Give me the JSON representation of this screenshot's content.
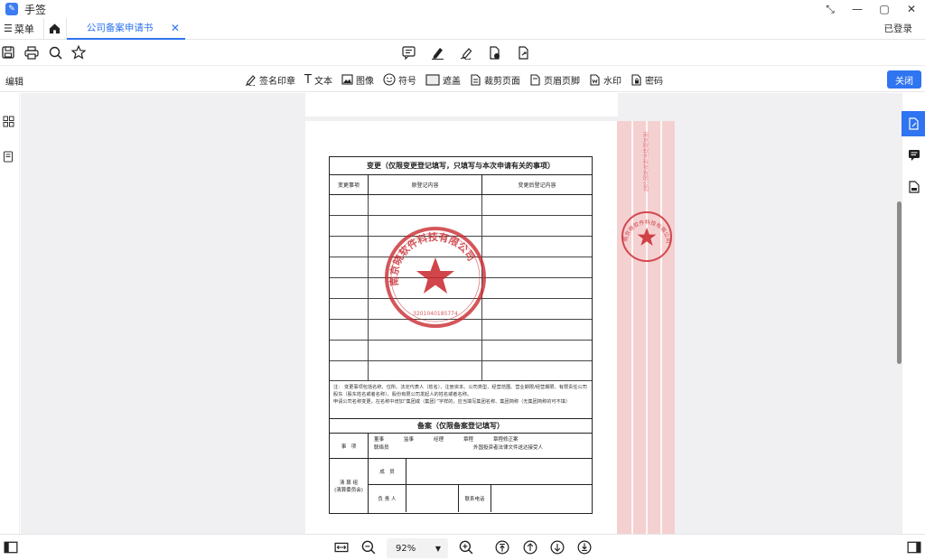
{
  "app": {
    "title": "手签",
    "icon": "app-logo-icon"
  },
  "window_controls": [
    "minimize-icon",
    "maximize-icon",
    "close-icon"
  ],
  "tabs": {
    "menu_label": "菜单",
    "active_tab": "公司备案申请书",
    "login": "已登录"
  },
  "toolbar_top": {
    "left_icons": [
      "save-icon",
      "print-icon",
      "search-icon",
      "star-icon"
    ],
    "center_icons": [
      "comment-icon",
      "highlight-pen-icon",
      "sign-pen-icon",
      "document-stamp-icon",
      "document-export-icon"
    ]
  },
  "edit_bar": {
    "label": "编辑",
    "tools": [
      {
        "label": "签名印章",
        "icon": "signature-icon"
      },
      {
        "label": "文本",
        "icon": "text-icon"
      },
      {
        "label": "图像",
        "icon": "image-icon"
      },
      {
        "label": "符号",
        "icon": "smiley-icon"
      },
      {
        "label": "遮盖",
        "icon": "mask-icon"
      },
      {
        "label": "裁剪页面",
        "icon": "crop-page-icon"
      },
      {
        "label": "页眉页脚",
        "icon": "header-footer-icon"
      },
      {
        "label": "水印",
        "icon": "watermark-icon"
      },
      {
        "label": "密码",
        "icon": "password-icon"
      }
    ],
    "close_label": "关闭"
  },
  "document": {
    "form_title": "变更（仅限变更登记填写，只填写与本次申请有关的事项）",
    "columns": [
      "变更事项",
      "原登记内容",
      "变更后登记内容"
    ],
    "notes_line1": "注：  变更事项包括名称、住所、法定代表人（姓名）、注册资本、公司类型、经营范围、营业期限/经营期限、有限责任公司股东（股东姓名或者名称）、股份有限公司发起人的姓名或者名称。",
    "notes_line2": "申请公司名称变更，在名称中增加“集团或（集团）”字样的，应当填写集团名称、集团简称（无集团简称的可不填）",
    "record_title": "备案（仅限备案登记填写）",
    "record_item_label": "事　项",
    "record_options_line1": "董事　　　　监事　　　　经理　　　　章程　　　　章程修正案",
    "record_options_line2": "联络员　　　　　　　　　　　　　　　　　外国投资者法律文件送达接受人",
    "liquidation_label": "清 算 组\n(清算委员会)",
    "member_label": "成　员",
    "leader_label": "负 责 人",
    "phone_label": "联系电话",
    "seal_text": "南京晓软件科技有限公司",
    "seal_number": "3201040185774"
  },
  "bottom": {
    "zoom": "92%"
  }
}
